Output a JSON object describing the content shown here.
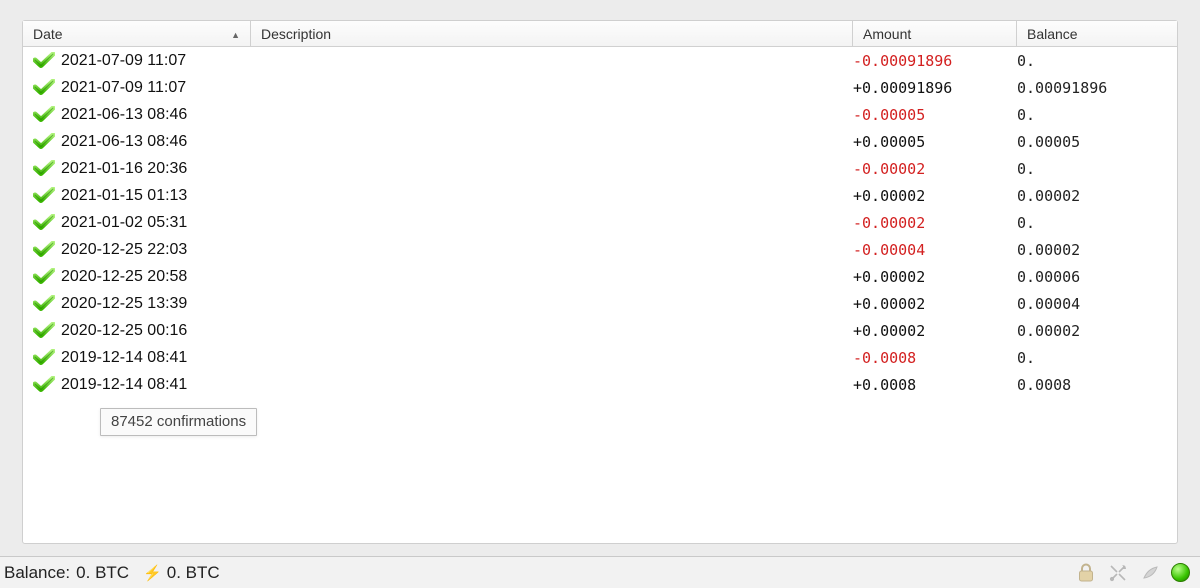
{
  "columns": {
    "date": "Date",
    "description": "Description",
    "amount": "Amount",
    "balance": "Balance"
  },
  "sort": {
    "column": "date",
    "direction": "asc"
  },
  "rows": [
    {
      "date": "2021-07-09 11:07",
      "amount": "-0.00091896",
      "neg": true,
      "balance": "0."
    },
    {
      "date": "2021-07-09 11:07",
      "amount": "+0.00091896",
      "neg": false,
      "balance": "0.00091896"
    },
    {
      "date": "2021-06-13 08:46",
      "amount": "-0.00005",
      "neg": true,
      "balance": "0."
    },
    {
      "date": "2021-06-13 08:46",
      "amount": "+0.00005",
      "neg": false,
      "balance": "0.00005"
    },
    {
      "date": "2021-01-16 20:36",
      "amount": "-0.00002",
      "neg": true,
      "balance": "0."
    },
    {
      "date": "2021-01-15 01:13",
      "amount": "+0.00002",
      "neg": false,
      "balance": "0.00002"
    },
    {
      "date": "2021-01-02 05:31",
      "amount": "-0.00002",
      "neg": true,
      "balance": "0."
    },
    {
      "date": "2020-12-25 22:03",
      "amount": "-0.00004",
      "neg": true,
      "balance": "0.00002"
    },
    {
      "date": "2020-12-25 20:58",
      "amount": "+0.00002",
      "neg": false,
      "balance": "0.00006"
    },
    {
      "date": "2020-12-25 13:39",
      "amount": "+0.00002",
      "neg": false,
      "balance": "0.00004"
    },
    {
      "date": "2020-12-25 00:16",
      "amount": "+0.00002",
      "neg": false,
      "balance": "0.00002"
    },
    {
      "date": "2019-12-14 08:41",
      "amount": "-0.0008",
      "neg": true,
      "balance": "0."
    },
    {
      "date": "2019-12-14 08:41",
      "amount": "+0.0008",
      "neg": false,
      "balance": "0.0008"
    }
  ],
  "tooltip": "87452 confirmations",
  "statusbar": {
    "balance_label": "Balance:",
    "balance_value": "0. BTC",
    "lightning_value": "0. BTC"
  },
  "icons": {
    "confirmed": "confirmed-check-icon",
    "lock": "lock-icon",
    "tools": "tools-icon",
    "seed": "seed-icon",
    "network": "network-status-led"
  }
}
